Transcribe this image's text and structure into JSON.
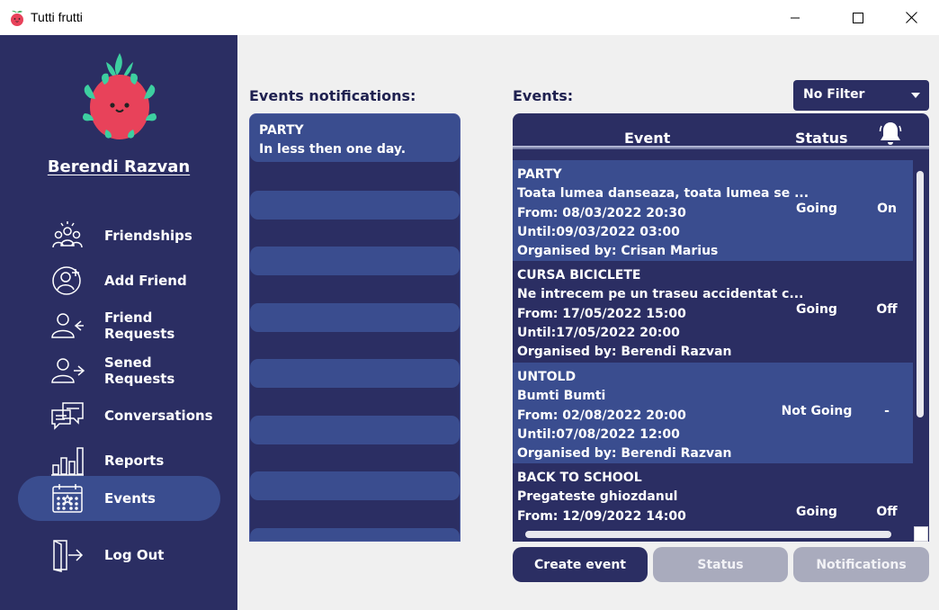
{
  "window": {
    "title": "Tutti frutti"
  },
  "sidebar": {
    "user_name": "Berendi Razvan",
    "items": [
      {
        "label": "Friendships",
        "icon": "group-icon"
      },
      {
        "label": "Add Friend",
        "icon": "add-user-icon"
      },
      {
        "label": "Friend Requests",
        "icon": "incoming-request-icon"
      },
      {
        "label": "Sened Requests",
        "icon": "outgoing-request-icon"
      },
      {
        "label": "Conversations",
        "icon": "chat-icon"
      },
      {
        "label": "Reports",
        "icon": "bar-chart-icon"
      },
      {
        "label": "Events",
        "icon": "calendar-icon",
        "active": true
      },
      {
        "label": "Log Out",
        "icon": "logout-icon"
      }
    ]
  },
  "notifications": {
    "title": "Events notifications:",
    "items": [
      {
        "title": "PARTY",
        "text": "In less then one day."
      }
    ]
  },
  "events": {
    "title": "Events:",
    "filter": "No Filter",
    "columns": {
      "event": "Event",
      "status": "Status",
      "notifications_icon": "bell-icon"
    },
    "rows": [
      {
        "name": "PARTY",
        "description": "Toata lumea danseaza, toata lumea se ...",
        "from": "From: 08/03/2022 20:30",
        "until": "Until:09/03/2022 03:00",
        "organiser": "Organised by: Crisan Marius",
        "status": "Going",
        "notifications": "On"
      },
      {
        "name": "CURSA BICICLETE",
        "description": "Ne intrecem pe un traseu accidentat c...",
        "from": "From: 17/05/2022 15:00",
        "until": "Until:17/05/2022 20:00",
        "organiser": "Organised by: Berendi Razvan",
        "status": "Going",
        "notifications": "Off"
      },
      {
        "name": "UNTOLD",
        "description": "Bumti Bumti",
        "from": "From: 02/08/2022 20:00",
        "until": "Until:07/08/2022 12:00",
        "organiser": "Organised by: Berendi Razvan",
        "status": "Not Going",
        "notifications": "-"
      },
      {
        "name": "BACK TO SCHOOL",
        "description": "Pregateste ghiozdanul",
        "from": "From: 12/09/2022 14:00",
        "until": "",
        "organiser": "",
        "status": "Going",
        "notifications": "Off"
      }
    ]
  },
  "buttons": {
    "create": "Create event",
    "status": "Status",
    "notifications": "Notifications"
  },
  "colors": {
    "navy": "#2b2e63",
    "highlight": "#3a4d8f",
    "disabled": "#a9abbd"
  }
}
